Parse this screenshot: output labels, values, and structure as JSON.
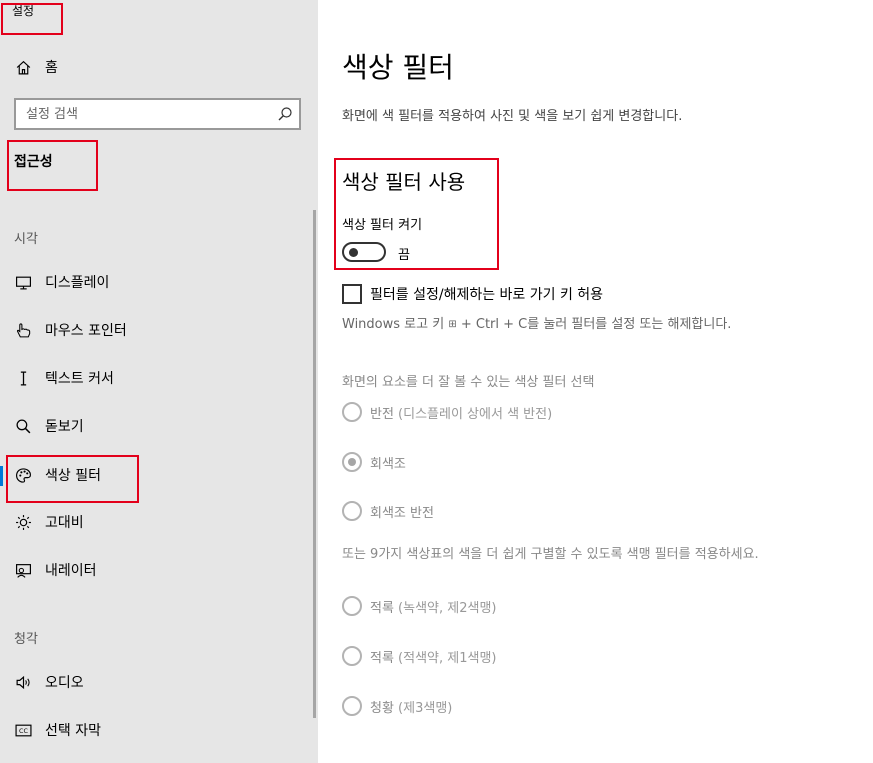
{
  "sidebar": {
    "app_title": "설정",
    "home_label": "홈",
    "search_placeholder": "설정 검색",
    "section_heading": "접근성",
    "group_vision": "시각",
    "group_hearing": "청각",
    "items": [
      {
        "label": "디스플레이",
        "icon": "monitor-icon"
      },
      {
        "label": "마우스 포인터",
        "icon": "pointer-hand-icon"
      },
      {
        "label": "텍스트 커서",
        "icon": "text-cursor-icon"
      },
      {
        "label": "돋보기",
        "icon": "magnifier-icon"
      },
      {
        "label": "색상 필터",
        "icon": "palette-icon",
        "selected": true
      },
      {
        "label": "고대비",
        "icon": "sun-icon"
      },
      {
        "label": "내레이터",
        "icon": "narrator-icon"
      },
      {
        "label": "오디오",
        "icon": "speaker-icon"
      },
      {
        "label": "선택 자막",
        "icon": "captions-icon"
      }
    ]
  },
  "main": {
    "title": "색상 필터",
    "description": "화면에 색 필터를 적용하여 사진 및 색을 보기 쉽게 변경합니다.",
    "subtitle": "색상 필터 사용",
    "toggle_label": "색상 필터 켜기",
    "toggle_state": "끔",
    "shortcut_checkbox_label": "필터를 설정/해제하는 바로 가기 키 허용",
    "shortcut_desc_before": "Windows 로고 키 ",
    "shortcut_desc_after": " + Ctrl + C를 눌러 필터를 설정 또는 해제합니다.",
    "filter_heading": "화면의 요소를 더 잘 볼 수 있는 색상 필터 선택",
    "filters": [
      {
        "main": "반전",
        "detail": " (디스플레이 상에서 색 반전)",
        "checked": false
      },
      {
        "main": "회색조",
        "detail": "",
        "checked": true
      },
      {
        "main": "회색조 반전",
        "detail": "",
        "checked": false
      }
    ],
    "colorblind_desc": "또는 9가지 색상표의 색을 더 쉽게 구별할 수 있도록 색맹 필터를 적용하세요.",
    "colorblind_filters": [
      {
        "main": "적록",
        "detail": " (녹색약, 제2색맹)",
        "checked": false
      },
      {
        "main": "적록",
        "detail": " (적색약, 제1색맹)",
        "checked": false
      },
      {
        "main": "청황",
        "detail": " (제3색맹)",
        "checked": false
      }
    ]
  },
  "colors": {
    "accent": "#0078d7",
    "highlight_box": "#e3001b",
    "sidebar_bg": "#e6e6e6"
  }
}
